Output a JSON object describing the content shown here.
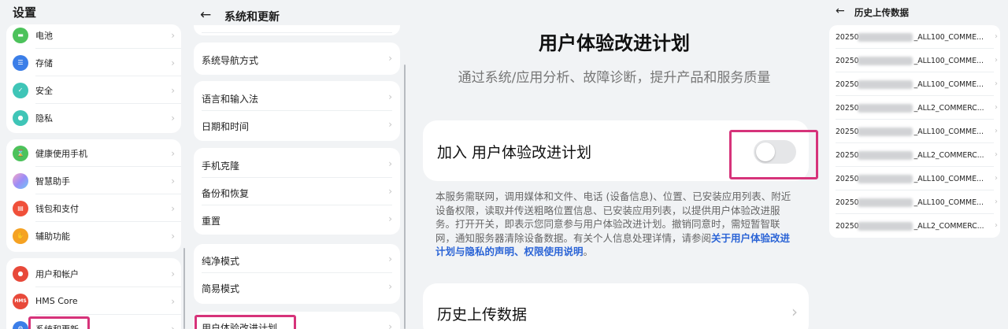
{
  "settings": {
    "title": "设置",
    "items": [
      {
        "label": "电池",
        "icon": "battery-icon",
        "color": "#4cc25b"
      },
      {
        "label": "存储",
        "icon": "storage-icon",
        "color": "#3b7ee8"
      },
      {
        "label": "安全",
        "icon": "security-icon",
        "color": "#3fc5b7"
      },
      {
        "label": "隐私",
        "icon": "privacy-icon",
        "color": "#3fc5b7"
      },
      {
        "label": "健康使用手机",
        "icon": "health-icon",
        "color": "#4cc25b"
      },
      {
        "label": "智慧助手",
        "icon": "assistant-icon",
        "color": "#b67cf0"
      },
      {
        "label": "钱包和支付",
        "icon": "wallet-icon",
        "color": "#f0503a"
      },
      {
        "label": "辅助功能",
        "icon": "accessibility-icon",
        "color": "#f5a223"
      },
      {
        "label": "用户和帐户",
        "icon": "user-icon",
        "color": "#e8493a"
      },
      {
        "label": "HMS Core",
        "icon": "hms-icon",
        "color": "#e8493a",
        "badge": "HMS"
      },
      {
        "label": "系统和更新",
        "icon": "system-icon",
        "color": "#3b7ee8"
      }
    ]
  },
  "system": {
    "title": "系统和更新",
    "items": [
      {
        "label": "系统导航方式"
      },
      {
        "label": "语言和输入法"
      },
      {
        "label": "日期和时间"
      },
      {
        "label": "手机克隆"
      },
      {
        "label": "备份和恢复"
      },
      {
        "label": "重置"
      },
      {
        "label": "纯净模式"
      },
      {
        "label": "简易模式"
      },
      {
        "label": "用户体验改进计划"
      }
    ]
  },
  "ux": {
    "title": "用户体验改进计划",
    "subtitle": "通过系统/应用分析、故障诊断，提升产品和服务质量",
    "join_label": "加入 用户体验改进计划",
    "join_enabled": false,
    "description": "本服务需联网，调用媒体和文件、电话 (设备信息)、位置、已安装应用列表、附近设备权限，读取并传送粗略位置信息、已安装应用列表，以提供用户体验改进服务。打开开关，即表示您同意参与用户体验改进计划。撤销同意时，需短暂智联网，通知服务器清除设备数据。有关个人信息处理详情，请参阅",
    "link_label": "关于用户体验改进计划与隐私的声明、权限使用说明",
    "description_end": "。",
    "history_label": "历史上传数据"
  },
  "history": {
    "title": "历史上传数据",
    "items": [
      {
        "prefix": "20250",
        "suffix": "_ALL100_COMME..."
      },
      {
        "prefix": "20250",
        "suffix": "_ALL100_COMME..."
      },
      {
        "prefix": "20250",
        "suffix": "_ALL100_COMME..."
      },
      {
        "prefix": "20250",
        "suffix": "_ALL2_COMMERC..."
      },
      {
        "prefix": "20250",
        "suffix": "_ALL100_COMME..."
      },
      {
        "prefix": "20250",
        "suffix": "_ALL2_COMMERC..."
      },
      {
        "prefix": "20250",
        "suffix": "_ALL100_COMME..."
      },
      {
        "prefix": "20250",
        "suffix": "_ALL100_COMME..."
      },
      {
        "prefix": "20250",
        "suffix": "_ALL2_COMMERC..."
      }
    ]
  },
  "colors": {
    "accent": "#2b64d6",
    "highlight": "#d6337a",
    "card": "#ffffff",
    "background": "#f1f3f5"
  }
}
